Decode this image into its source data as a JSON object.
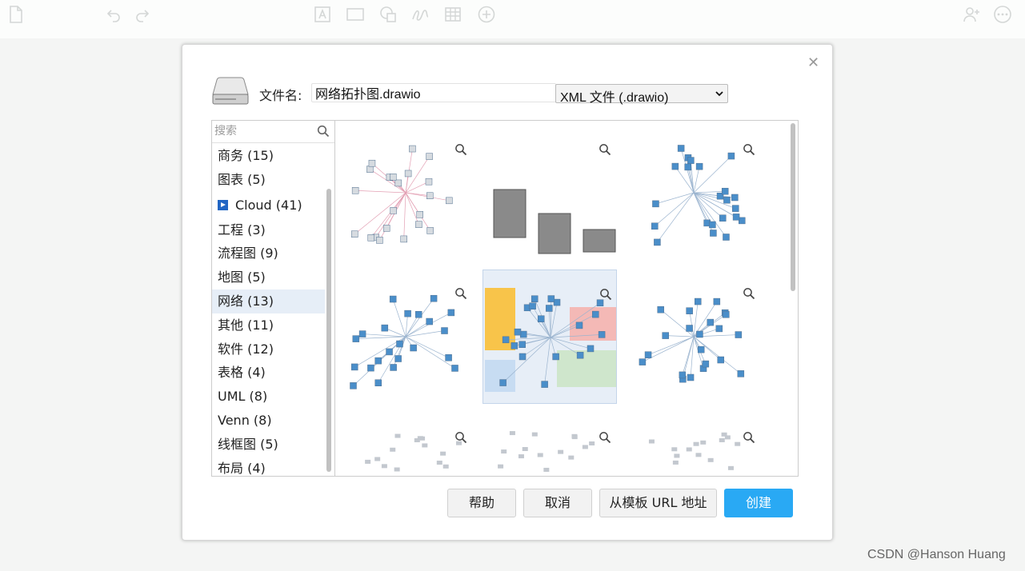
{
  "toolbar": {
    "icons": [
      "page-icon",
      "undo-icon",
      "redo-icon",
      "text-icon",
      "rectangle-icon",
      "shapes-icon",
      "freehand-icon",
      "table-icon",
      "insert-icon",
      "share-icon",
      "more-icon"
    ]
  },
  "dialog": {
    "filename_label": "文件名:",
    "filename_value": "网络拓扑图.drawio",
    "filetype_value": "XML 文件 (.drawio)",
    "search_placeholder": "搜索",
    "categories": [
      {
        "label": "商务 (15)"
      },
      {
        "label": "图表 (5)"
      },
      {
        "label": "Cloud (41)"
      },
      {
        "label": "工程 (3)"
      },
      {
        "label": "流程图 (9)"
      },
      {
        "label": "地图 (5)"
      },
      {
        "label": "网络 (13)",
        "selected": true
      },
      {
        "label": "其他 (11)"
      },
      {
        "label": "软件 (12)"
      },
      {
        "label": "表格 (4)"
      },
      {
        "label": "UML (8)"
      },
      {
        "label": "Venn (8)"
      },
      {
        "label": "线框图 (5)"
      },
      {
        "label": "布局 (4)"
      }
    ],
    "selected_template_index": 4,
    "buttons": {
      "help": "帮助",
      "cancel": "取消",
      "from_url": "从模板 URL 地址",
      "create": "创建"
    },
    "colors": {
      "primary_button": "#29a9f4",
      "selected_category_bg": "#e6eef7",
      "selected_tile_bg": "#e7eef7"
    }
  },
  "watermark": "CSDN @Hanson Huang"
}
